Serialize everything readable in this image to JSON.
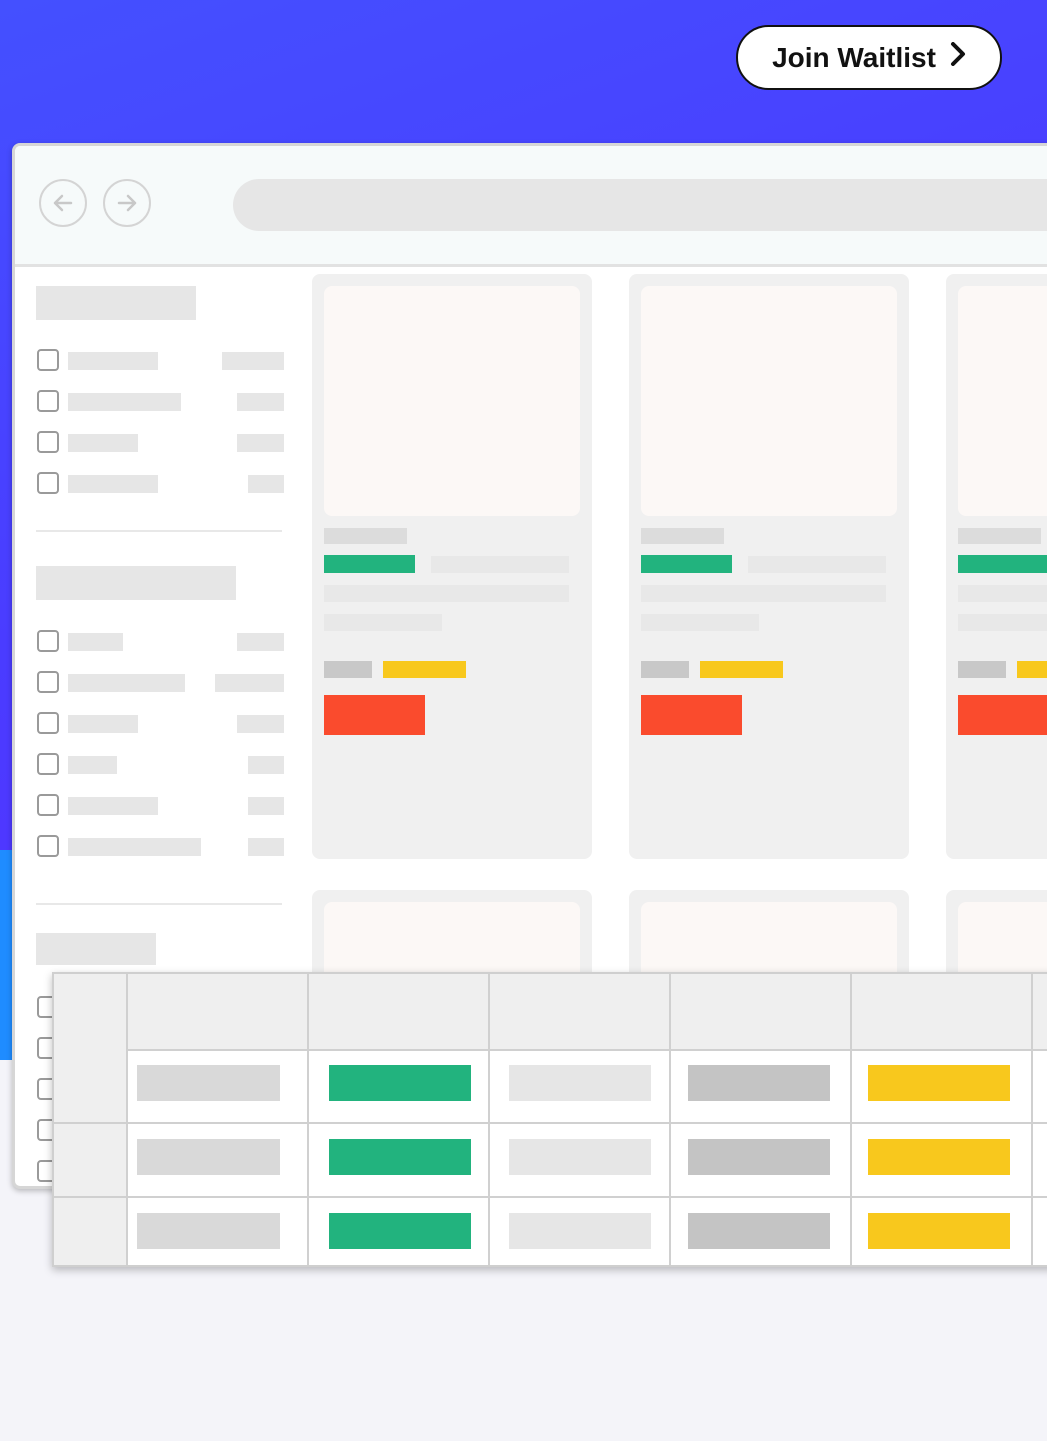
{
  "header": {
    "join_button_label": "Join Waitlist",
    "join_button_icon": "chevron-right-icon"
  },
  "colors": {
    "hero_background": "#4a3cff",
    "accent_green": "#22b37e",
    "accent_yellow": "#f8c81d",
    "accent_red": "#fa4b2d",
    "placeholder_gray": "#e6e6e6"
  },
  "browser": {
    "back_icon": "arrow-left-icon",
    "forward_icon": "arrow-right-icon"
  }
}
